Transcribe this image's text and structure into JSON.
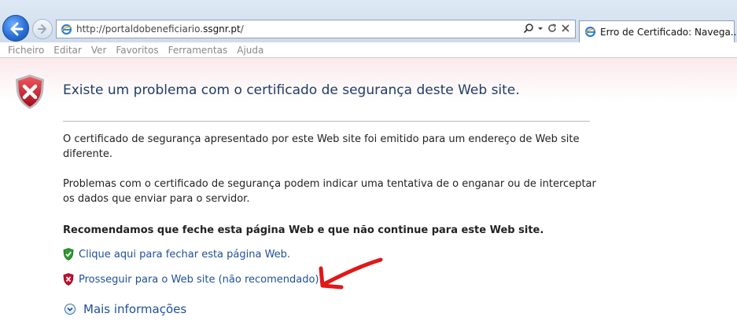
{
  "browser": {
    "address_url_prefix": "http://portaldobeneficiario.",
    "address_url_host": "ssgnr.pt",
    "address_url_suffix": "/",
    "tab_title": "Erro de Certificado: Navega..."
  },
  "menu": [
    "Ficheiro",
    "Editar",
    "Ver",
    "Favoritos",
    "Ferramentas",
    "Ajuda"
  ],
  "page": {
    "title": "Existe um problema com o certificado de segurança deste Web site.",
    "paragraph1": "O certificado de segurança apresentado por este Web site foi emitido para um endereço de Web site diferente.",
    "paragraph2": "Problemas com o certificado de segurança podem indicar uma tentativa de o enganar ou de interceptar os dados que enviar para o servidor.",
    "recommendation": "Recomendamos que feche esta página Web e que não continue para este Web site.",
    "close_link": "Clique aqui para fechar esta página Web.",
    "continue_link": "Prosseguir para o Web site (não recomendado).",
    "more_info": "Mais informações"
  },
  "colors": {
    "link": "#1f4f9a",
    "title": "#1f3d66",
    "arrow": "#e01818",
    "shield_red": "#c8102e",
    "shield_green": "#2e9a32"
  }
}
